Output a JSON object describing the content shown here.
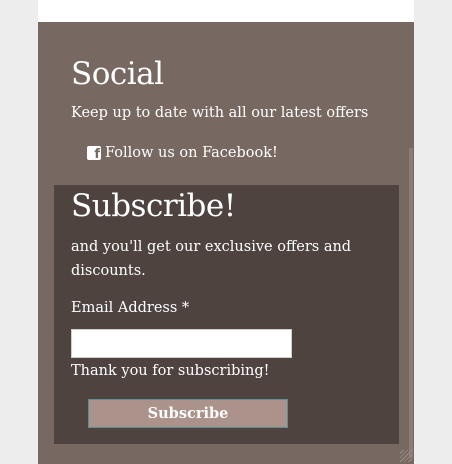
{
  "social": {
    "heading": "Social",
    "text": "Keep up to date with all our latest offers",
    "facebook_label": "Follow us on Facebook!",
    "facebook_icon": "facebook-square-icon"
  },
  "subscribe": {
    "heading": "Subscribe!",
    "text": "and you'll get our exclusive offers and discounts.",
    "email_label": "Email Address *",
    "email_value": "",
    "thanks": "Thank you for subscribing!",
    "button_label": "Subscribe"
  },
  "colors": {
    "footer_bg": "#786862",
    "subscribe_bg": "#4e433f",
    "button_bg": "#ab928a"
  }
}
